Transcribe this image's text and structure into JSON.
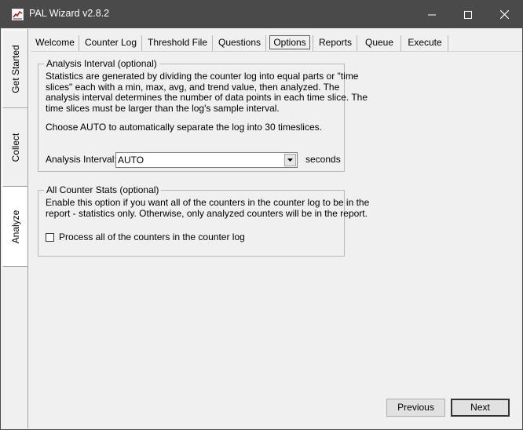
{
  "window": {
    "title": "PAL Wizard v2.8.2",
    "icon": "pal-chart-icon",
    "controls": [
      "minimize-icon",
      "maximize-icon",
      "close-icon"
    ]
  },
  "side_tabs": [
    {
      "label": "Get Started"
    },
    {
      "label": "Collect"
    },
    {
      "label": "Analyze",
      "active": true
    }
  ],
  "tabs": [
    {
      "label": "Welcome"
    },
    {
      "label": "Counter Log"
    },
    {
      "label": "Threshold File"
    },
    {
      "label": "Questions"
    },
    {
      "label": "Options",
      "active": true
    },
    {
      "label": "Reports"
    },
    {
      "label": "Queue"
    },
    {
      "label": "Execute"
    }
  ],
  "analysis_interval": {
    "group_title": "Analysis Interval (optional)",
    "desc_lines": [
      "Statistics are generated by dividing the counter log into equal parts or \"time",
      "slices\" each with a min, max, avg, and trend value, then analyzed. The",
      "analysis interval determines the number of data points in each time slice. The",
      "time slices must be larger than the log's sample interval."
    ],
    "auto_note": "Choose AUTO to automatically separate the log into 30 timeslices.",
    "field_label": "Analysis Interval:",
    "value": "AUTO",
    "unit": "seconds"
  },
  "counter_stats": {
    "group_title": "All Counter Stats (optional)",
    "desc_lines": [
      "Enable this option if you want all of the counters in the counter log to be in the",
      "report - statistics only. Otherwise, only analyzed counters will be in the report."
    ],
    "checkbox_label": "Process all of the counters in the counter log",
    "checked": false
  },
  "buttons": {
    "previous": "Previous",
    "next": "Next"
  }
}
